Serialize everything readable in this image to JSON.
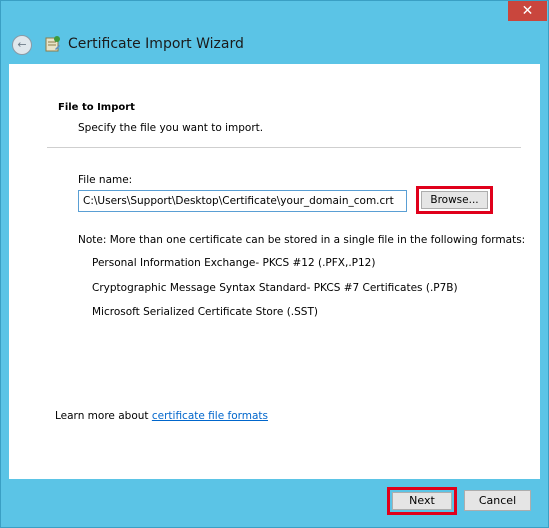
{
  "window": {
    "title": "Certificate Import Wizard",
    "close_glyph": "✕",
    "back_glyph": "←",
    "icons": {
      "back": "back-arrow-icon",
      "wizard": "certificate-wizard-icon",
      "close": "close-icon"
    }
  },
  "page": {
    "section_title": "File to Import",
    "section_subtitle": "Specify the file you want to import.",
    "file_label": "File name:",
    "file_value": "C:\\Users\\Support\\Desktop\\Certificate\\your_domain_com.crt",
    "browse_label": "Browse...",
    "note": "Note:  More than one certificate can be stored in a single file in the following formats:",
    "formats": [
      "Personal Information Exchange- PKCS #12 (.PFX,.P12)",
      "Cryptographic Message Syntax Standard- PKCS #7 Certificates (.P7B)",
      "Microsoft Serialized Certificate Store (.SST)"
    ],
    "learn_prefix": "Learn more about ",
    "learn_link": "certificate file formats"
  },
  "footer": {
    "next_label": "Next",
    "cancel_label": "Cancel"
  },
  "colors": {
    "frame": "#5bc4e6",
    "highlight": "#e0001b",
    "close": "#c9463d",
    "link": "#0066cc"
  }
}
